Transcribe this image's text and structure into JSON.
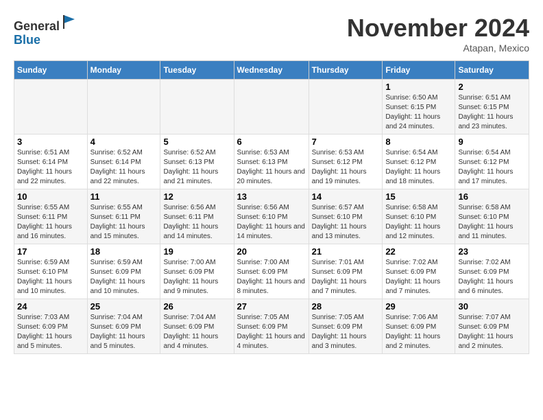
{
  "header": {
    "logo_line1": "General",
    "logo_line2": "Blue",
    "month": "November 2024",
    "location": "Atapan, Mexico"
  },
  "weekdays": [
    "Sunday",
    "Monday",
    "Tuesday",
    "Wednesday",
    "Thursday",
    "Friday",
    "Saturday"
  ],
  "weeks": [
    [
      {
        "day": "",
        "sunrise": "",
        "sunset": "",
        "daylight": ""
      },
      {
        "day": "",
        "sunrise": "",
        "sunset": "",
        "daylight": ""
      },
      {
        "day": "",
        "sunrise": "",
        "sunset": "",
        "daylight": ""
      },
      {
        "day": "",
        "sunrise": "",
        "sunset": "",
        "daylight": ""
      },
      {
        "day": "",
        "sunrise": "",
        "sunset": "",
        "daylight": ""
      },
      {
        "day": "1",
        "sunrise": "Sunrise: 6:50 AM",
        "sunset": "Sunset: 6:15 PM",
        "daylight": "Daylight: 11 hours and 24 minutes."
      },
      {
        "day": "2",
        "sunrise": "Sunrise: 6:51 AM",
        "sunset": "Sunset: 6:15 PM",
        "daylight": "Daylight: 11 hours and 23 minutes."
      }
    ],
    [
      {
        "day": "3",
        "sunrise": "Sunrise: 6:51 AM",
        "sunset": "Sunset: 6:14 PM",
        "daylight": "Daylight: 11 hours and 22 minutes."
      },
      {
        "day": "4",
        "sunrise": "Sunrise: 6:52 AM",
        "sunset": "Sunset: 6:14 PM",
        "daylight": "Daylight: 11 hours and 22 minutes."
      },
      {
        "day": "5",
        "sunrise": "Sunrise: 6:52 AM",
        "sunset": "Sunset: 6:13 PM",
        "daylight": "Daylight: 11 hours and 21 minutes."
      },
      {
        "day": "6",
        "sunrise": "Sunrise: 6:53 AM",
        "sunset": "Sunset: 6:13 PM",
        "daylight": "Daylight: 11 hours and 20 minutes."
      },
      {
        "day": "7",
        "sunrise": "Sunrise: 6:53 AM",
        "sunset": "Sunset: 6:12 PM",
        "daylight": "Daylight: 11 hours and 19 minutes."
      },
      {
        "day": "8",
        "sunrise": "Sunrise: 6:54 AM",
        "sunset": "Sunset: 6:12 PM",
        "daylight": "Daylight: 11 hours and 18 minutes."
      },
      {
        "day": "9",
        "sunrise": "Sunrise: 6:54 AM",
        "sunset": "Sunset: 6:12 PM",
        "daylight": "Daylight: 11 hours and 17 minutes."
      }
    ],
    [
      {
        "day": "10",
        "sunrise": "Sunrise: 6:55 AM",
        "sunset": "Sunset: 6:11 PM",
        "daylight": "Daylight: 11 hours and 16 minutes."
      },
      {
        "day": "11",
        "sunrise": "Sunrise: 6:55 AM",
        "sunset": "Sunset: 6:11 PM",
        "daylight": "Daylight: 11 hours and 15 minutes."
      },
      {
        "day": "12",
        "sunrise": "Sunrise: 6:56 AM",
        "sunset": "Sunset: 6:11 PM",
        "daylight": "Daylight: 11 hours and 14 minutes."
      },
      {
        "day": "13",
        "sunrise": "Sunrise: 6:56 AM",
        "sunset": "Sunset: 6:10 PM",
        "daylight": "Daylight: 11 hours and 14 minutes."
      },
      {
        "day": "14",
        "sunrise": "Sunrise: 6:57 AM",
        "sunset": "Sunset: 6:10 PM",
        "daylight": "Daylight: 11 hours and 13 minutes."
      },
      {
        "day": "15",
        "sunrise": "Sunrise: 6:58 AM",
        "sunset": "Sunset: 6:10 PM",
        "daylight": "Daylight: 11 hours and 12 minutes."
      },
      {
        "day": "16",
        "sunrise": "Sunrise: 6:58 AM",
        "sunset": "Sunset: 6:10 PM",
        "daylight": "Daylight: 11 hours and 11 minutes."
      }
    ],
    [
      {
        "day": "17",
        "sunrise": "Sunrise: 6:59 AM",
        "sunset": "Sunset: 6:10 PM",
        "daylight": "Daylight: 11 hours and 10 minutes."
      },
      {
        "day": "18",
        "sunrise": "Sunrise: 6:59 AM",
        "sunset": "Sunset: 6:09 PM",
        "daylight": "Daylight: 11 hours and 10 minutes."
      },
      {
        "day": "19",
        "sunrise": "Sunrise: 7:00 AM",
        "sunset": "Sunset: 6:09 PM",
        "daylight": "Daylight: 11 hours and 9 minutes."
      },
      {
        "day": "20",
        "sunrise": "Sunrise: 7:00 AM",
        "sunset": "Sunset: 6:09 PM",
        "daylight": "Daylight: 11 hours and 8 minutes."
      },
      {
        "day": "21",
        "sunrise": "Sunrise: 7:01 AM",
        "sunset": "Sunset: 6:09 PM",
        "daylight": "Daylight: 11 hours and 7 minutes."
      },
      {
        "day": "22",
        "sunrise": "Sunrise: 7:02 AM",
        "sunset": "Sunset: 6:09 PM",
        "daylight": "Daylight: 11 hours and 7 minutes."
      },
      {
        "day": "23",
        "sunrise": "Sunrise: 7:02 AM",
        "sunset": "Sunset: 6:09 PM",
        "daylight": "Daylight: 11 hours and 6 minutes."
      }
    ],
    [
      {
        "day": "24",
        "sunrise": "Sunrise: 7:03 AM",
        "sunset": "Sunset: 6:09 PM",
        "daylight": "Daylight: 11 hours and 5 minutes."
      },
      {
        "day": "25",
        "sunrise": "Sunrise: 7:04 AM",
        "sunset": "Sunset: 6:09 PM",
        "daylight": "Daylight: 11 hours and 5 minutes."
      },
      {
        "day": "26",
        "sunrise": "Sunrise: 7:04 AM",
        "sunset": "Sunset: 6:09 PM",
        "daylight": "Daylight: 11 hours and 4 minutes."
      },
      {
        "day": "27",
        "sunrise": "Sunrise: 7:05 AM",
        "sunset": "Sunset: 6:09 PM",
        "daylight": "Daylight: 11 hours and 4 minutes."
      },
      {
        "day": "28",
        "sunrise": "Sunrise: 7:05 AM",
        "sunset": "Sunset: 6:09 PM",
        "daylight": "Daylight: 11 hours and 3 minutes."
      },
      {
        "day": "29",
        "sunrise": "Sunrise: 7:06 AM",
        "sunset": "Sunset: 6:09 PM",
        "daylight": "Daylight: 11 hours and 2 minutes."
      },
      {
        "day": "30",
        "sunrise": "Sunrise: 7:07 AM",
        "sunset": "Sunset: 6:09 PM",
        "daylight": "Daylight: 11 hours and 2 minutes."
      }
    ]
  ]
}
